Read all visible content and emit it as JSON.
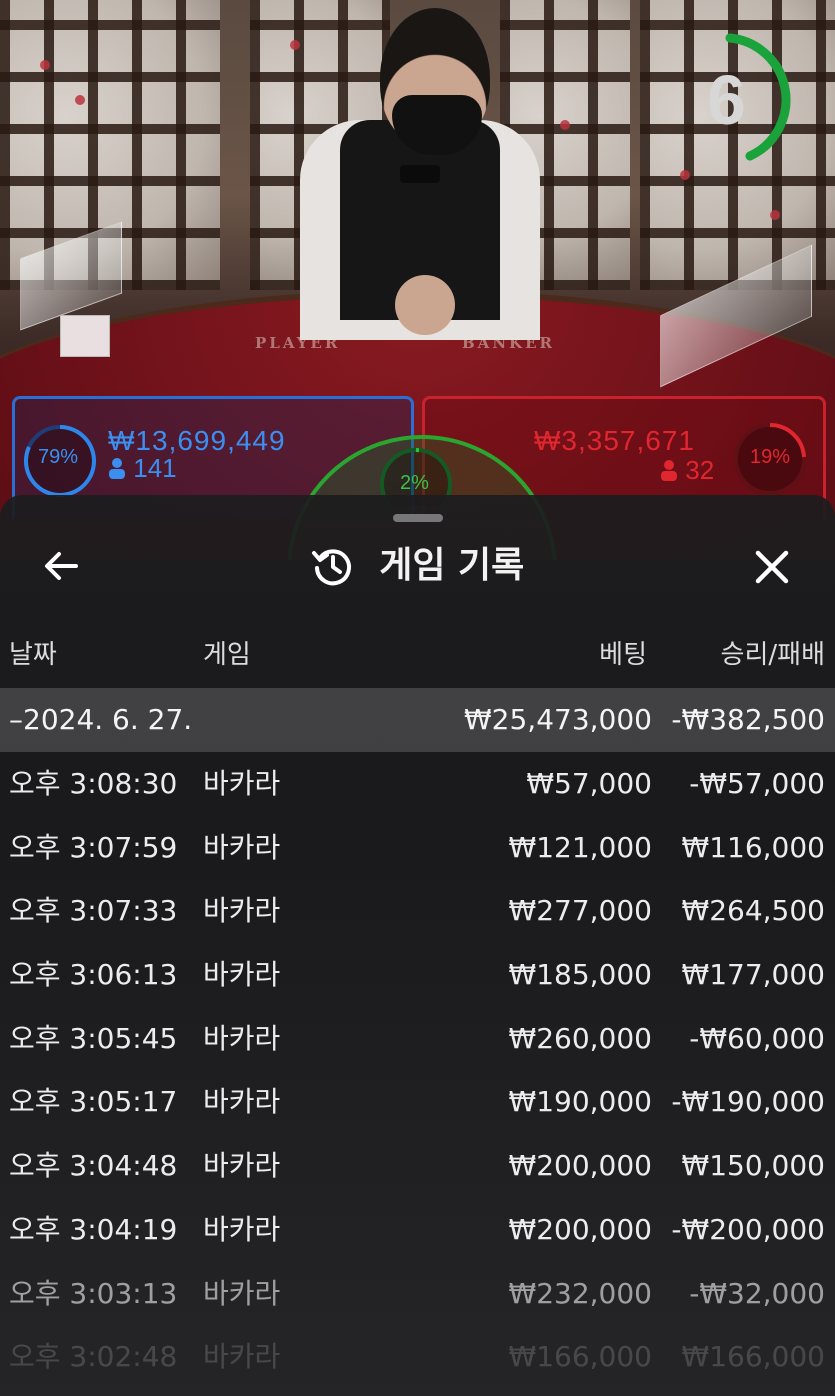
{
  "live_table": {
    "timer": "6",
    "felt_player_label": "PLAYER",
    "felt_banker_label": "BANKER",
    "player": {
      "percent": "79%",
      "amount": "₩13,699,449",
      "count": "141",
      "color": "#2a6fd6"
    },
    "banker": {
      "percent": "19%",
      "amount": "₩3,357,671",
      "count": "32",
      "color": "#c8232c"
    },
    "tie": {
      "percent": "2%",
      "color": "#2aa52f"
    }
  },
  "history": {
    "title": "게임 기록",
    "back_icon": "arrow-left-icon",
    "title_icon": "history-clock-icon",
    "close_icon": "close-x-icon",
    "columns": {
      "date": "날짜",
      "game": "게임",
      "bet": "베팅",
      "result": "승리/패배"
    },
    "date_group": {
      "label": "–2024. 6. 27.",
      "total_bet": "₩25,473,000",
      "total_result": "-₩382,500"
    },
    "rows": [
      {
        "time": "오후 3:08:30",
        "game": "바카라",
        "bet": "₩57,000",
        "result": "-₩57,000"
      },
      {
        "time": "오후 3:07:59",
        "game": "바카라",
        "bet": "₩121,000",
        "result": "₩116,000"
      },
      {
        "time": "오후 3:07:33",
        "game": "바카라",
        "bet": "₩277,000",
        "result": "₩264,500"
      },
      {
        "time": "오후 3:06:13",
        "game": "바카라",
        "bet": "₩185,000",
        "result": "₩177,000"
      },
      {
        "time": "오후 3:05:45",
        "game": "바카라",
        "bet": "₩260,000",
        "result": "-₩60,000"
      },
      {
        "time": "오후 3:05:17",
        "game": "바카라",
        "bet": "₩190,000",
        "result": "-₩190,000"
      },
      {
        "time": "오후 3:04:48",
        "game": "바카라",
        "bet": "₩200,000",
        "result": "₩150,000"
      },
      {
        "time": "오후 3:04:19",
        "game": "바카라",
        "bet": "₩200,000",
        "result": "-₩200,000"
      },
      {
        "time": "오후 3:03:13",
        "game": "바카라",
        "bet": "₩232,000",
        "result": "-₩32,000"
      },
      {
        "time": "오후 3:02:48",
        "game": "바카라",
        "bet": "₩166,000",
        "result": "₩166,000"
      }
    ]
  }
}
